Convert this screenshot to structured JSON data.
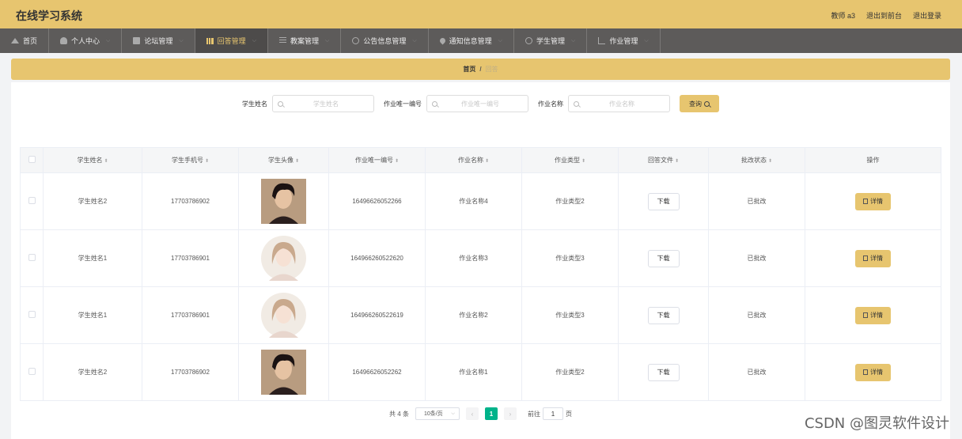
{
  "header": {
    "title": "在线学习系统",
    "user": "教师 a3",
    "front_link": "退出到前台",
    "logout": "退出登录"
  },
  "nav": [
    {
      "label": "首页",
      "icon": "home-icon"
    },
    {
      "label": "个人中心",
      "icon": "user-icon"
    },
    {
      "label": "论坛管理",
      "icon": "forum-icon"
    },
    {
      "label": "回答管理",
      "icon": "bar-chart-icon",
      "active": true
    },
    {
      "label": "教案管理",
      "icon": "list-icon"
    },
    {
      "label": "公告信息管理",
      "icon": "globe-icon"
    },
    {
      "label": "通知信息管理",
      "icon": "pin-icon"
    },
    {
      "label": "学生管理",
      "icon": "globe-icon"
    },
    {
      "label": "作业管理",
      "icon": "crop-icon"
    }
  ],
  "breadcrumb": {
    "home": "首页",
    "sep": "/",
    "current": "回答"
  },
  "search": {
    "student_name_label": "学生姓名",
    "student_name_placeholder": "学生姓名",
    "hw_id_label": "作业唯一编号",
    "hw_id_placeholder": "作业唯一编号",
    "hw_name_label": "作业名称",
    "hw_name_placeholder": "作业名称",
    "query_label": "查询"
  },
  "table": {
    "columns": [
      "学生姓名",
      "学生手机号",
      "学生头像",
      "作业唯一编号",
      "作业名称",
      "作业类型",
      "回答文件",
      "批改状态",
      "操作"
    ],
    "rows": [
      {
        "name": "学生姓名2",
        "phone": "17703786902",
        "avatar": "male",
        "hw_id": "16496626052266",
        "hw_name": "作业名称4",
        "hw_type": "作业类型2",
        "download": "下载",
        "status": "已批改",
        "detail": "详情"
      },
      {
        "name": "学生姓名1",
        "phone": "17703786901",
        "avatar": "female",
        "hw_id": "164966260522620",
        "hw_name": "作业名称3",
        "hw_type": "作业类型3",
        "download": "下载",
        "status": "已批改",
        "detail": "详情"
      },
      {
        "name": "学生姓名1",
        "phone": "17703786901",
        "avatar": "female",
        "hw_id": "164966260522619",
        "hw_name": "作业名称2",
        "hw_type": "作业类型3",
        "download": "下载",
        "status": "已批改",
        "detail": "详情"
      },
      {
        "name": "学生姓名2",
        "phone": "17703786902",
        "avatar": "male",
        "hw_id": "16496626052262",
        "hw_name": "作业名称1",
        "hw_type": "作业类型2",
        "download": "下载",
        "status": "已批改",
        "detail": "详情"
      }
    ]
  },
  "pagination": {
    "total": "共 4 条",
    "page_size": "10条/页",
    "current_page": "1",
    "goto_label": "前往",
    "goto_value": "1",
    "page_suffix": "页"
  },
  "watermark": "CSDN @图灵软件设计",
  "colors": {
    "accent": "#e7c56f",
    "nav_bg": "#5d5b5a",
    "page_active": "#00b38a"
  }
}
